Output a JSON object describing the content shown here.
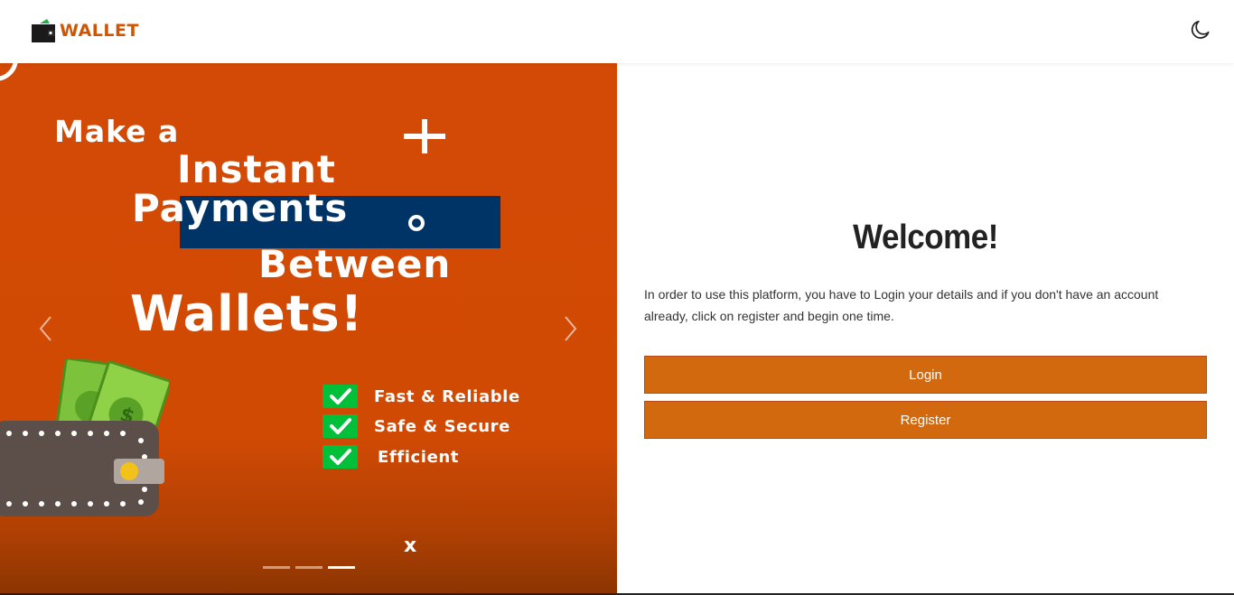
{
  "header": {
    "brand": "WALLET",
    "logo_icon": "wallet-logo-icon",
    "theme_icon": "moon-icon"
  },
  "hero": {
    "line1": "Make a",
    "line2": "Instant",
    "line3": "Payments",
    "line4": "Between",
    "line5": "Wallets!",
    "features": [
      "Fast & Reliable",
      "Safe & Secure",
      "Efficient"
    ],
    "x_mark": "x",
    "slide_count": 3,
    "active_slide": 3,
    "colors": {
      "background": "#d24a05",
      "accent_box": "#003366",
      "check": "#00c03a"
    }
  },
  "welcome": {
    "title": "Welcome!",
    "intro": "In order to use this platform, you have to Login your details and if you don't have an account already, click on register and begin one time.",
    "login_label": "Login",
    "register_label": "Register",
    "button_color": "#d2690e"
  }
}
